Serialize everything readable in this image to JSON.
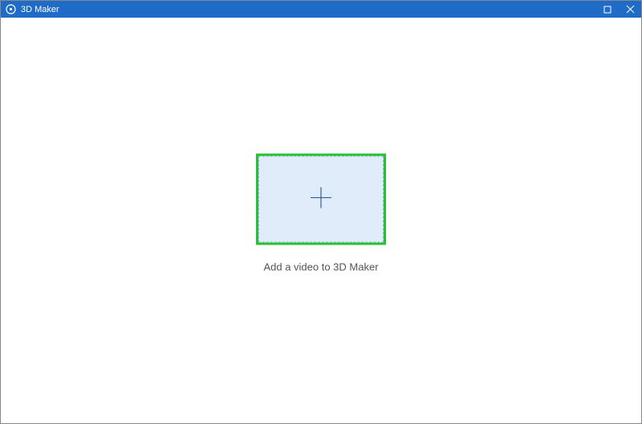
{
  "window": {
    "title": "3D Maker"
  },
  "main": {
    "drop_label": "Add a video to 3D Maker"
  }
}
